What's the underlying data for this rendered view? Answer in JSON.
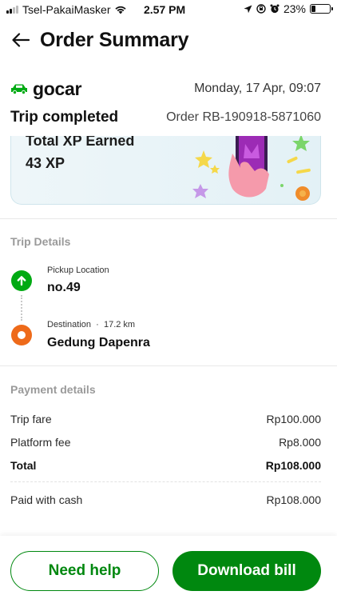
{
  "status_bar": {
    "carrier": "Tsel-PakaiMasker",
    "time": "2.57 PM",
    "battery": "23%",
    "battery_level": 0.23,
    "signal_bars_filled": 2,
    "icons": [
      "signal-icon",
      "wifi-icon",
      "location-arrow-icon",
      "lock-rotation-icon",
      "alarm-icon",
      "battery-icon"
    ]
  },
  "header": {
    "title": "Order Summary",
    "back_icon": "arrow-left-icon"
  },
  "order": {
    "brand": "gocar",
    "brand_icon": "car-icon",
    "date": "Monday, 17 Apr, 09:07",
    "status": "Trip completed",
    "order_id": "Order RB-190918-5871060"
  },
  "xp_card": {
    "label": "Total XP Earned",
    "value": "43 XP"
  },
  "trip_details": {
    "title": "Trip Details",
    "pickup": {
      "label": "Pickup Location",
      "name": "no.49",
      "icon": "arrow-up-icon"
    },
    "destination": {
      "label": "Destination",
      "distance": "17.2 km",
      "name": "Gedung Dapenra",
      "icon": "destination-dot-icon"
    }
  },
  "payment": {
    "title": "Payment details",
    "rows": [
      {
        "label": "Trip fare",
        "value": "Rp100.000"
      },
      {
        "label": "Platform fee",
        "value": "Rp8.000"
      },
      {
        "label": "Total",
        "value": "Rp108.000"
      }
    ],
    "method": {
      "label": "Paid with cash",
      "value": "Rp108.000"
    }
  },
  "actions": {
    "help_label": "Need help",
    "download_label": "Download bill"
  },
  "colors": {
    "brand_green": "#00880f",
    "pickup_green": "#00aa13",
    "destination_orange": "#ee6a1a"
  }
}
